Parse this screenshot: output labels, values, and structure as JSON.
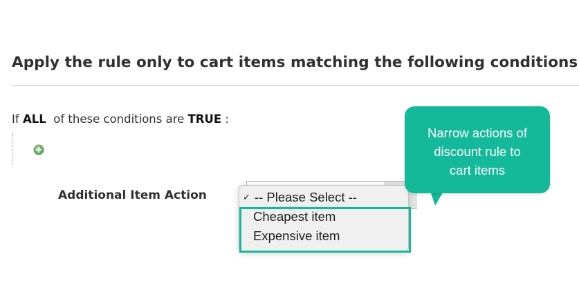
{
  "section": {
    "title": "Apply the rule only to cart items matching the following conditions"
  },
  "conditions": {
    "prefix": "If",
    "aggregator": "ALL",
    "middle": "of these conditions are",
    "value": "TRUE",
    "suffix": " :"
  },
  "add_condition_icon": "plus-circle-icon",
  "field": {
    "label": "Additional Item Action",
    "dropdown_options": [
      "-- Please Select --",
      "Cheapest item",
      "Expensive item"
    ],
    "selected": "-- Please Select --",
    "checkmark": "✓"
  },
  "callout": {
    "lines": [
      "Narrow actions of",
      "discount rule to",
      "cart items"
    ]
  },
  "colors": {
    "accent": "#14b99a",
    "highlight_border": "#15b89b",
    "add_icon": "#3d9a3d"
  }
}
